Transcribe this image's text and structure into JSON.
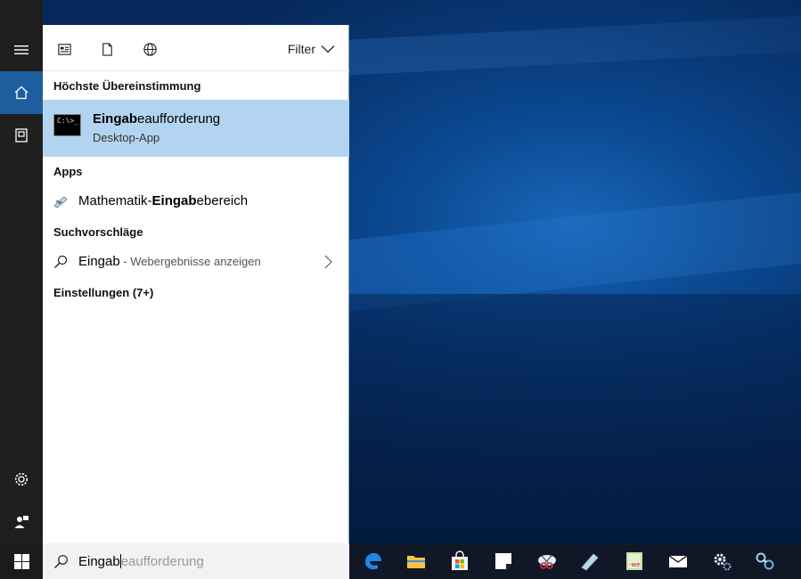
{
  "search_panel": {
    "filter_label": "Filter",
    "best_match": {
      "section_title": "Höchste Übereinstimmung",
      "title_bold": "Eingab",
      "title_rest": "eaufforderung",
      "subtitle": "Desktop-App",
      "icon_text": "C:\\>_"
    },
    "apps": {
      "section_title": "Apps",
      "items": [
        {
          "pre": "Mathematik-",
          "bold": "Eingab",
          "post": "ebereich"
        }
      ]
    },
    "suggestions": {
      "section_title": "Suchvorschläge",
      "items": [
        {
          "query": "Eingab",
          "hint": " - Webergebnisse anzeigen"
        }
      ]
    },
    "settings": {
      "section_title": "Einstellungen (7+)"
    }
  },
  "taskbar": {
    "search": {
      "typed": "Eingab",
      "completion": "eaufforderung"
    },
    "icons": [
      "edge-icon",
      "file-explorer-icon",
      "store-icon",
      "sticky-notes-icon",
      "snipping-tool-icon",
      "math-input-icon",
      "notepad-icon",
      "mail-icon",
      "settings-icon",
      "network-icon"
    ]
  },
  "colors": {
    "accent": "#1f5e9e",
    "selection": "#b3d4f0",
    "rail": "#1f1f1f"
  }
}
